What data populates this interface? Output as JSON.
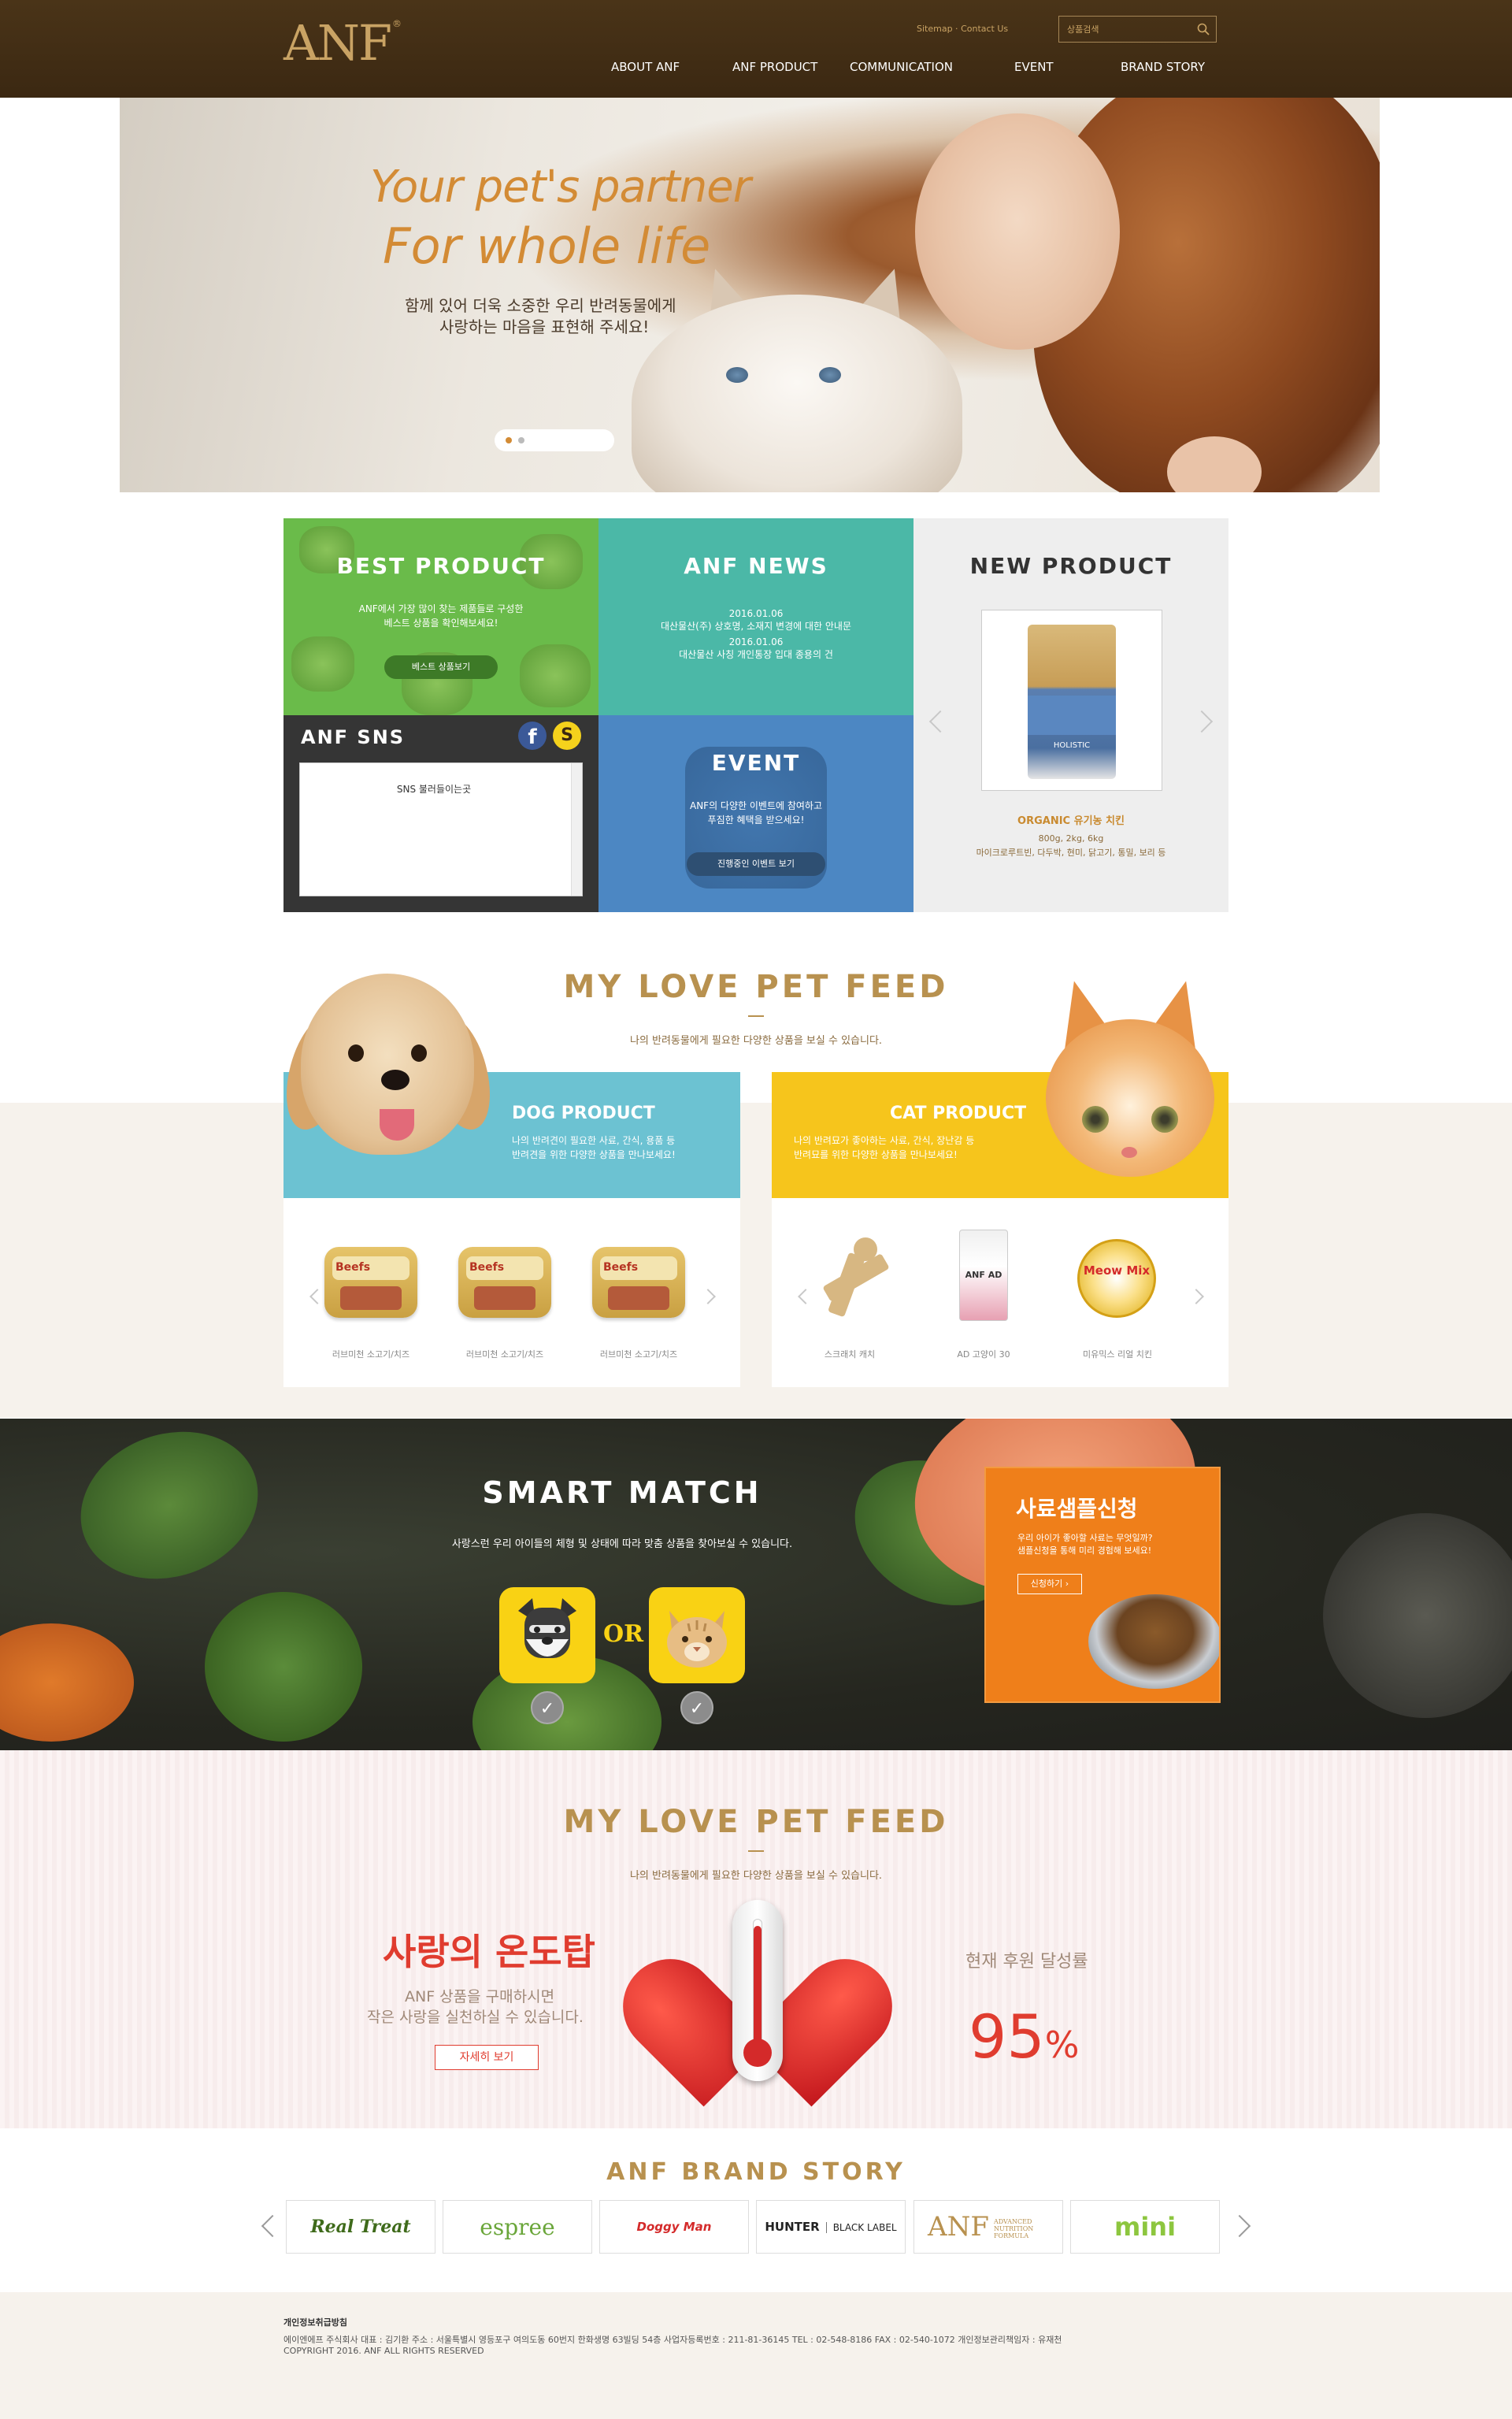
{
  "header": {
    "logo": "ANF",
    "logo_mark": "®",
    "util_sitemap": "Sitemap",
    "util_sep": " · ",
    "util_contact": "Contact Us",
    "search_placeholder": "상품검색",
    "nav": [
      "ABOUT ANF",
      "ANF PRODUCT",
      "COMMUNICATION",
      "EVENT",
      "BRAND STORY"
    ]
  },
  "hero": {
    "title1": "Your pet's partner",
    "title2": "For whole life",
    "sub1": "함께 있어 더욱 소중한 우리 반려동물에게",
    "sub2": "사랑하는 마음을 표현해 주세요!",
    "active_slide": 1,
    "slide_count": 2,
    "accent": "#d38b35"
  },
  "best": {
    "title": "BEST PRODUCT",
    "desc1": "ANF에서 가장 많이 찾는 제품들로 구성한",
    "desc2": "베스트 상품을 확인해보세요!",
    "button": "베스트 상품보기",
    "color": "#6abb4a"
  },
  "news": {
    "title": "ANF NEWS",
    "items": [
      {
        "date": "2016.01.06",
        "text": "대산물산(주) 상호명, 소재지 변경에 대한 안내문"
      },
      {
        "date": "2016.01.06",
        "text": "대산물산 사칭 개인통장 입대 종용의 건"
      }
    ],
    "color": "#4bb8a7"
  },
  "sns": {
    "title": "ANF SNS",
    "placeholder": "SNS 불러들이는곳",
    "facebook": "f",
    "kakaostory": "S"
  },
  "event": {
    "title": "EVENT",
    "desc1": "ANF의 다양한 이벤트에 참여하고",
    "desc2": "푸짐한 혜택을 받으세요!",
    "button": "진행중인 이벤트 보기",
    "color": "#4c87c3"
  },
  "new_product": {
    "title": "NEW PRODUCT",
    "bag_label": "HOLISTIC",
    "name": "ORGANIC 유기농 치킨",
    "sizes": "800g, 2kg, 6kg",
    "ingredients": "마이크로루트빈, 다두박, 현미, 닭고기, 통밀, 보리 등"
  },
  "pet_feed": {
    "title": "MY LOVE PET FEED",
    "sub": "나의 반려동물에게 필요한 다양한 상품을 보실 수 있습니다.",
    "dog": {
      "title": "DOG PRODUCT",
      "desc1": "나의 반려견이 필요한 사료, 간식, 용품 등",
      "desc2": "반려견을 위한 다양한 상품을 만나보세요!",
      "products": [
        "러브미천 소고기/치즈",
        "러브미천 소고기/치즈",
        "러브미천 소고기/치즈"
      ],
      "tray_text": "Beefs"
    },
    "cat": {
      "title": "CAT PRODUCT",
      "desc1": "나의 반려묘가 좋아하는 사료, 간식, 장난감 등",
      "desc2": "반려묘를 위한 다양한 상품을 만나보세요!",
      "products": [
        "스크래치 캐치",
        "AD 고양이 30",
        "미유믹스 리얼 치킨"
      ],
      "bag_text": "ANF AD",
      "can_text": "Meow Mix"
    }
  },
  "smart_match": {
    "title": "SMART MATCH",
    "sub": "사랑스런 우리 아이들의 체형 및 상태에 따라 맞춤 상품을 찾아보실 수 있습니다.",
    "or": "OR",
    "check": "✓",
    "dog_icon": "dog-face-icon",
    "cat_icon": "cat-face-icon"
  },
  "sample": {
    "title": "사료샘플신청",
    "desc1": "우리 아이가 좋아할 사료는 무엇일까?",
    "desc2": "샘플신청을 통해 미리 경험해 보세요!",
    "button": "신청하기 ›"
  },
  "donation": {
    "title": "MY LOVE PET FEED",
    "sub": "나의 반려동물에게 필요한 다양한 상품을 보실 수 있습니다.",
    "headline": "사랑의 온도탑",
    "desc1": "ANF 상품을 구매하시면",
    "desc2": "작은 사랑을 실천하실 수 있습니다.",
    "button": "자세히 보기",
    "rate_label": "현재 후원 달성률",
    "rate_value": "95",
    "rate_unit": "%",
    "rate_fraction": 0.95
  },
  "brand_story": {
    "title": "ANF BRAND STORY",
    "brands": {
      "real": "Real Treat",
      "espree": "espree",
      "doggy": "Doggy Man",
      "hunter": "HUNTER",
      "hunter_sub": "BLACK LABEL",
      "anf": "ANF",
      "anf_sub": "ADVANCED NUTRITION FORMULA",
      "mini": "mini"
    }
  },
  "footer": {
    "policy": "개인정보취급방침",
    "company": "에이엔에프 주식회사 대표 : 김기환 주소 : 서울특별시 영등포구 여의도동 60번지 한화생명 63빌딩 54층 사업자등록번호 : 211-81-36145 TEL : 02-548-8186 FAX : 02-540-1072 개인정보관리책임자 : 유재천",
    "copyright": "COPYRIGHT 2016. ANF ALL RIGHTS RESERVED"
  }
}
